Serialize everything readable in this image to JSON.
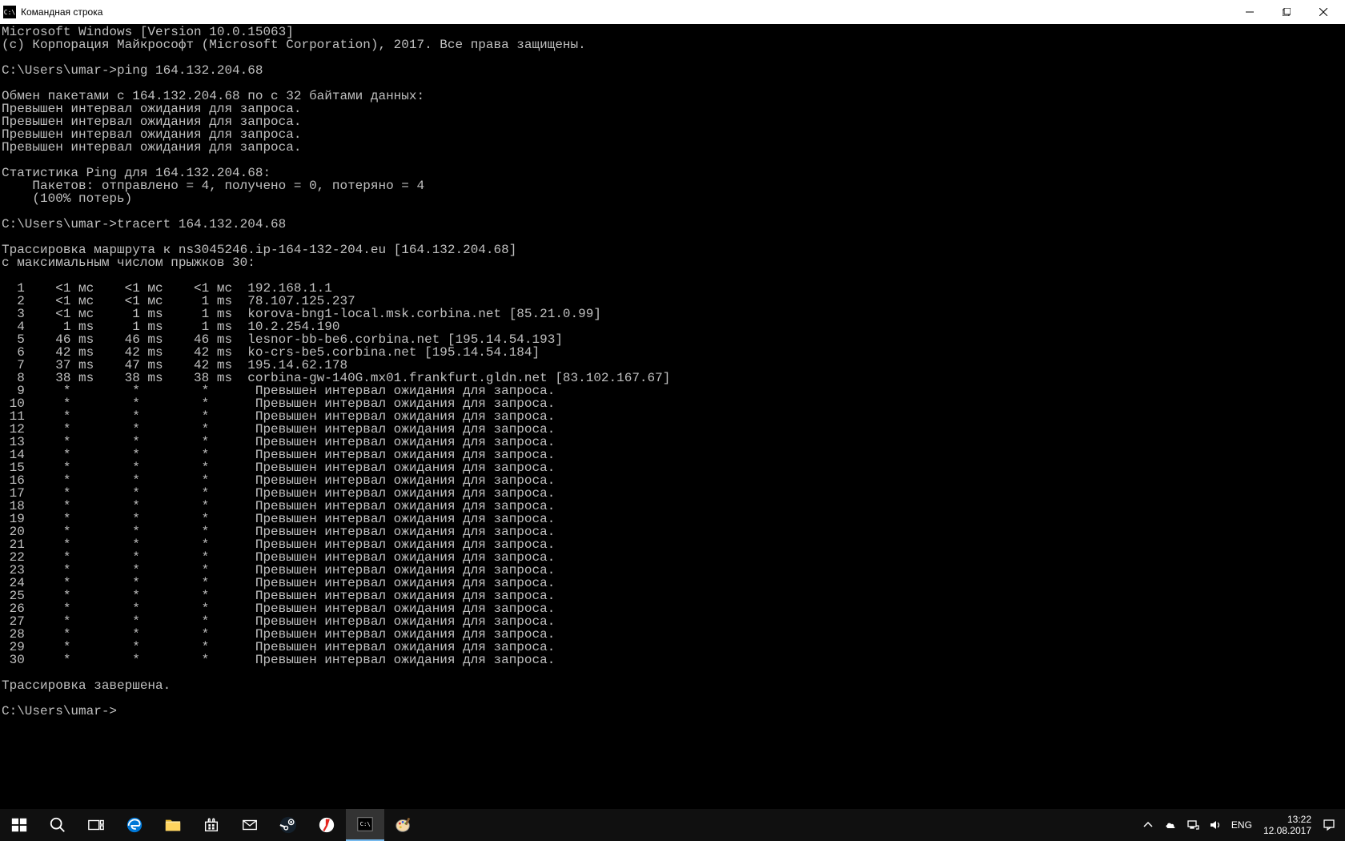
{
  "title": "Командная строка",
  "terminal": {
    "header1": "Microsoft Windows [Version 10.0.15063]",
    "header2": "(c) Корпорация Майкрософт (Microsoft Corporation), 2017. Все права защищены.",
    "prompt_ping": "C:\\Users\\umar->ping 164.132.204.68",
    "ping_exchange": "Обмен пакетами с 164.132.204.68 по с 32 байтами данных:",
    "ping_timeout": "Превышен интервал ожидания для запроса.",
    "ping_stats_header": "Статистика Ping для 164.132.204.68:",
    "ping_stats_packets": "    Пакетов: отправлено = 4, получено = 0, потеряно = 4",
    "ping_stats_loss": "    (100% потерь)",
    "prompt_tracert": "C:\\Users\\umar->tracert 164.132.204.68",
    "tracert_header1": "Трассировка маршрута к ns3045246.ip-164-132-204.eu [164.132.204.68]",
    "tracert_header2": "с максимальным числом прыжков 30:",
    "hops": [
      {
        "n": "  1",
        "a": "   <1 мс",
        "b": "   <1 мс",
        "c": "   <1 мс",
        "h": "192.168.1.1"
      },
      {
        "n": "  2",
        "a": "   <1 мс",
        "b": "   <1 мс",
        "c": "    1 ms",
        "h": "78.107.125.237"
      },
      {
        "n": "  3",
        "a": "   <1 мс",
        "b": "    1 ms",
        "c": "    1 ms",
        "h": "korova-bng1-local.msk.corbina.net [85.21.0.99]"
      },
      {
        "n": "  4",
        "a": "    1 ms",
        "b": "    1 ms",
        "c": "    1 ms",
        "h": "10.2.254.190"
      },
      {
        "n": "  5",
        "a": "   46 ms",
        "b": "   46 ms",
        "c": "   46 ms",
        "h": "lesnor-bb-be6.corbina.net [195.14.54.193]"
      },
      {
        "n": "  6",
        "a": "   42 ms",
        "b": "   42 ms",
        "c": "   42 ms",
        "h": "ko-crs-be5.corbina.net [195.14.54.184]"
      },
      {
        "n": "  7",
        "a": "   37 ms",
        "b": "   47 ms",
        "c": "   42 ms",
        "h": "195.14.62.178"
      },
      {
        "n": "  8",
        "a": "   38 ms",
        "b": "   38 ms",
        "c": "   38 ms",
        "h": "corbina-gw-140G.mx01.frankfurt.gldn.net [83.102.167.67]"
      },
      {
        "n": "  9",
        "a": "    *   ",
        "b": "    *   ",
        "c": "    *   ",
        "h": " Превышен интервал ожидания для запроса."
      },
      {
        "n": " 10",
        "a": "    *   ",
        "b": "    *   ",
        "c": "    *   ",
        "h": " Превышен интервал ожидания для запроса."
      },
      {
        "n": " 11",
        "a": "    *   ",
        "b": "    *   ",
        "c": "    *   ",
        "h": " Превышен интервал ожидания для запроса."
      },
      {
        "n": " 12",
        "a": "    *   ",
        "b": "    *   ",
        "c": "    *   ",
        "h": " Превышен интервал ожидания для запроса."
      },
      {
        "n": " 13",
        "a": "    *   ",
        "b": "    *   ",
        "c": "    *   ",
        "h": " Превышен интервал ожидания для запроса."
      },
      {
        "n": " 14",
        "a": "    *   ",
        "b": "    *   ",
        "c": "    *   ",
        "h": " Превышен интервал ожидания для запроса."
      },
      {
        "n": " 15",
        "a": "    *   ",
        "b": "    *   ",
        "c": "    *   ",
        "h": " Превышен интервал ожидания для запроса."
      },
      {
        "n": " 16",
        "a": "    *   ",
        "b": "    *   ",
        "c": "    *   ",
        "h": " Превышен интервал ожидания для запроса."
      },
      {
        "n": " 17",
        "a": "    *   ",
        "b": "    *   ",
        "c": "    *   ",
        "h": " Превышен интервал ожидания для запроса."
      },
      {
        "n": " 18",
        "a": "    *   ",
        "b": "    *   ",
        "c": "    *   ",
        "h": " Превышен интервал ожидания для запроса."
      },
      {
        "n": " 19",
        "a": "    *   ",
        "b": "    *   ",
        "c": "    *   ",
        "h": " Превышен интервал ожидания для запроса."
      },
      {
        "n": " 20",
        "a": "    *   ",
        "b": "    *   ",
        "c": "    *   ",
        "h": " Превышен интервал ожидания для запроса."
      },
      {
        "n": " 21",
        "a": "    *   ",
        "b": "    *   ",
        "c": "    *   ",
        "h": " Превышен интервал ожидания для запроса."
      },
      {
        "n": " 22",
        "a": "    *   ",
        "b": "    *   ",
        "c": "    *   ",
        "h": " Превышен интервал ожидания для запроса."
      },
      {
        "n": " 23",
        "a": "    *   ",
        "b": "    *   ",
        "c": "    *   ",
        "h": " Превышен интервал ожидания для запроса."
      },
      {
        "n": " 24",
        "a": "    *   ",
        "b": "    *   ",
        "c": "    *   ",
        "h": " Превышен интервал ожидания для запроса."
      },
      {
        "n": " 25",
        "a": "    *   ",
        "b": "    *   ",
        "c": "    *   ",
        "h": " Превышен интервал ожидания для запроса."
      },
      {
        "n": " 26",
        "a": "    *   ",
        "b": "    *   ",
        "c": "    *   ",
        "h": " Превышен интервал ожидания для запроса."
      },
      {
        "n": " 27",
        "a": "    *   ",
        "b": "    *   ",
        "c": "    *   ",
        "h": " Превышен интервал ожидания для запроса."
      },
      {
        "n": " 28",
        "a": "    *   ",
        "b": "    *   ",
        "c": "    *   ",
        "h": " Превышен интервал ожидания для запроса."
      },
      {
        "n": " 29",
        "a": "    *   ",
        "b": "    *   ",
        "c": "    *   ",
        "h": " Превышен интервал ожидания для запроса."
      },
      {
        "n": " 30",
        "a": "    *   ",
        "b": "    *   ",
        "c": "    *   ",
        "h": " Превышен интервал ожидания для запроса."
      }
    ],
    "tracert_done": "Трассировка завершена.",
    "prompt_idle": "C:\\Users\\umar->"
  },
  "taskbar": {
    "lang": "ENG",
    "time": "13:22",
    "date": "12.08.2017"
  }
}
